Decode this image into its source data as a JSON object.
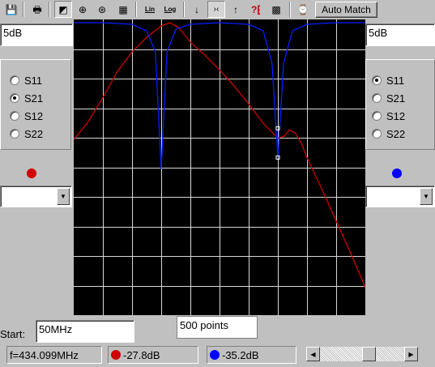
{
  "toolbar": {
    "buttons": [
      {
        "icon": "save-icon",
        "glyph": "💾"
      },
      {
        "icon": "print-icon",
        "glyph": "🖶"
      },
      {
        "icon": "chart-view-icon",
        "glyph": "◩"
      },
      {
        "icon": "smith-chart-icon",
        "glyph": "⊕"
      },
      {
        "icon": "polar-chart-icon",
        "glyph": "⊛"
      },
      {
        "icon": "table-icon",
        "glyph": "▦"
      },
      {
        "icon": "arrow-down-icon",
        "glyph": "↓"
      },
      {
        "icon": "narrow-icon",
        "glyph": "›‹"
      },
      {
        "icon": "arrow-up-icon",
        "glyph": "↑"
      },
      {
        "icon": "help-icon",
        "glyph": "?⁅"
      },
      {
        "icon": "grid-icon",
        "glyph": "▩"
      },
      {
        "icon": "timer-icon",
        "glyph": "⌚"
      }
    ],
    "lin_label": "Lin",
    "log_label": "Log",
    "auto_match_label": "Auto Match"
  },
  "left_panel": {
    "scale_value": "5dB",
    "params": [
      "S11",
      "S21",
      "S12",
      "S22"
    ],
    "selected": "S21",
    "marker_color": "#d00000"
  },
  "right_panel": {
    "scale_value": "5dB",
    "params": [
      "S11",
      "S21",
      "S12",
      "S22"
    ],
    "selected": "S11",
    "marker_color": "#0000ff"
  },
  "sweep": {
    "start_label": "Start:",
    "start_value": "50MHz",
    "points_value": "500 points"
  },
  "status": {
    "frequency": "f=434.099MHz",
    "left_reading": "-27.8dB",
    "right_reading": "-35.2dB"
  },
  "scrollbar": {
    "position": 0.6
  },
  "colors": {
    "plot_bg": "#000000",
    "grid": "#d8d8d8",
    "trace_left": "#cc0000",
    "trace_right": "#0020ff"
  },
  "chart_data": {
    "type": "line",
    "grid": true,
    "x_divisions": 10,
    "y_divisions": 10,
    "series": [
      {
        "color": "#cc0000",
        "x": [
          0.0,
          0.05,
          0.1,
          0.15,
          0.2,
          0.25,
          0.3,
          0.33,
          0.36,
          0.4,
          0.45,
          0.5,
          0.55,
          0.6,
          0.65,
          0.7,
          0.72,
          0.74,
          0.76,
          0.78,
          0.8,
          0.85,
          0.9,
          0.95,
          1.0
        ],
        "y": [
          -7.2,
          -6.1,
          -4.6,
          -3.0,
          -1.8,
          -0.9,
          -0.2,
          0.0,
          -0.3,
          -1.2,
          -2.0,
          -2.9,
          -3.9,
          -5.0,
          -6.2,
          -7.1,
          -7.0,
          -6.6,
          -6.8,
          -7.4,
          -8.3,
          -10.2,
          -12.2,
          -14.2,
          -16.3
        ]
      },
      {
        "color": "#0020ff",
        "x": [
          0.0,
          0.1,
          0.2,
          0.25,
          0.28,
          0.3,
          0.32,
          0.35,
          0.4,
          0.5,
          0.6,
          0.65,
          0.68,
          0.7,
          0.72,
          0.75,
          0.8,
          0.9,
          1.0
        ],
        "y": [
          0.0,
          0.0,
          -0.1,
          -0.5,
          -1.8,
          -9.0,
          -1.8,
          -0.4,
          -0.1,
          0.0,
          -0.1,
          -0.5,
          -2.5,
          -8.3,
          -2.5,
          -0.5,
          -0.1,
          0.0,
          0.0
        ]
      }
    ],
    "markers": [
      {
        "series": 0,
        "x": 0.7,
        "y": -6.5
      },
      {
        "series": 1,
        "x": 0.7,
        "y": -8.3
      }
    ],
    "ylim": [
      -18,
      0.2
    ],
    "xlim": [
      0,
      1
    ]
  }
}
